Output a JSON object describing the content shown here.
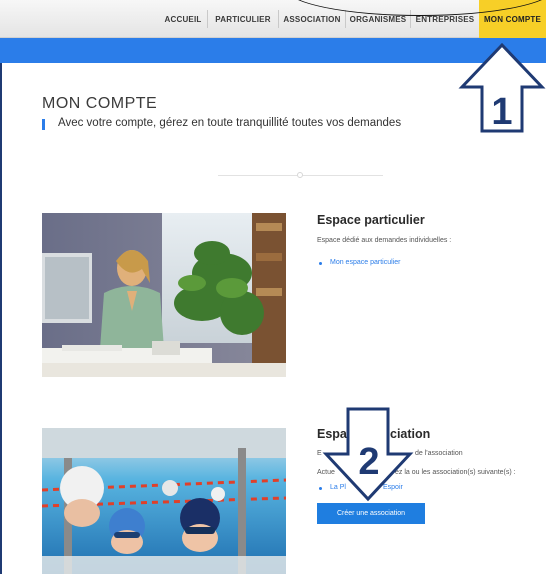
{
  "nav": {
    "items": [
      {
        "label": "ACCUEIL"
      },
      {
        "label": "PARTICULIER"
      },
      {
        "label": "ASSOCIATION"
      },
      {
        "label": "ORGANISMES"
      },
      {
        "label": "ENTREPRISES"
      },
      {
        "label": "MON COMPTE"
      }
    ],
    "active_color": "#f7cf27"
  },
  "header": {
    "bar_color": "#2b7de9"
  },
  "page": {
    "title": "MON COMPTE",
    "subtitle": "Avec votre compte, gérez en toute tranquillité toutes vos demandes"
  },
  "particulier": {
    "title": "Espace particulier",
    "description": "Espace dédié aux demandes individuelles :",
    "link": "Mon espace particulier"
  },
  "association": {
    "title_start": "Espa",
    "title_end": "ciation",
    "line1_start": "E",
    "line1_end": "de l'association",
    "line2_start": "Actue",
    "line2_end": "ez la ou les association(s) suivante(s) :",
    "link_start": "La Pl",
    "link_end": "Espoir",
    "button": "Créer une association"
  },
  "annotations": {
    "step1": "1",
    "step2": "2",
    "color": "#1f3a73"
  }
}
